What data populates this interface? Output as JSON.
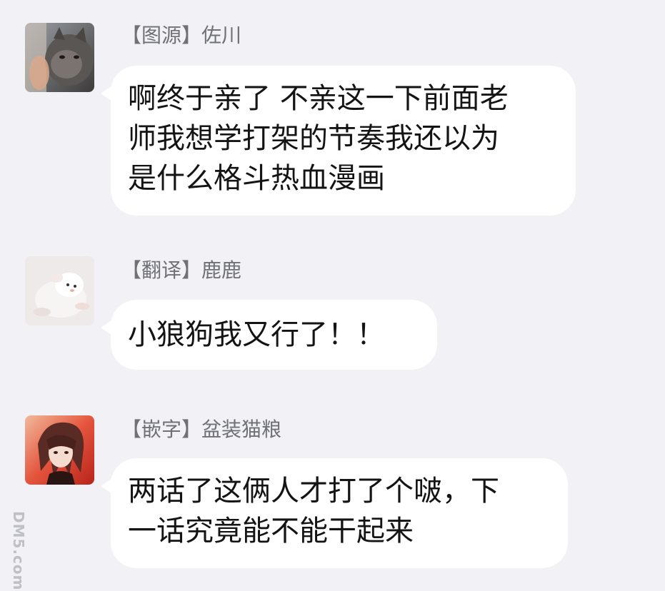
{
  "messages": [
    {
      "avatar": "cat-photo-avatar",
      "name": "【图源】佐川",
      "lines": [
        "啊终于亲了 不亲这一下前面老",
        "师我想学打架的节奏我还以为",
        "是什么格斗热血漫画"
      ]
    },
    {
      "avatar": "white-puppy-avatar",
      "name": "【翻译】鹿鹿",
      "lines": [
        "小狼狗我又行了！！"
      ]
    },
    {
      "avatar": "anime-character-avatar",
      "name": "【嵌字】盆装猫粮",
      "lines": [
        "两话了这俩人才打了个啵，下",
        "一话究竟能不能干起来"
      ]
    }
  ],
  "watermark": {
    "text": "DM5.com"
  }
}
